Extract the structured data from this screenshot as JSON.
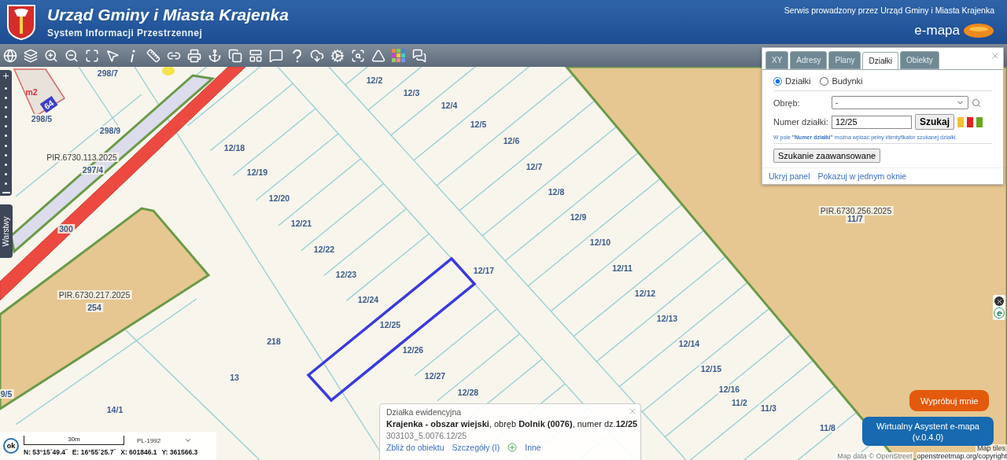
{
  "header": {
    "title": "Urząd Gminy i Miasta Krajenka",
    "subtitle": "System Informacji Przestrzennej",
    "operator": "Serwis prowadzony przez Urząd Gminy i Miasta Krajenka",
    "brand": "e-mapa"
  },
  "map_labels": [
    {
      "text": "298/7",
      "kind": "parcel"
    },
    {
      "text": "298/5",
      "kind": "parcel"
    },
    {
      "text": "298/9",
      "kind": "parcel"
    },
    {
      "text": "PIR.6730.113.2025",
      "kind": "plan"
    },
    {
      "text": "297/4",
      "kind": "parcel"
    },
    {
      "text": "300",
      "kind": "parcel"
    },
    {
      "text": "PIR.6730.217.2025",
      "kind": "plan"
    },
    {
      "text": "254",
      "kind": "parcel"
    },
    {
      "text": "m2",
      "kind": "building"
    },
    {
      "text": "64",
      "kind": "number"
    },
    {
      "text": "12/2",
      "kind": "parcel"
    },
    {
      "text": "12/3",
      "kind": "parcel"
    },
    {
      "text": "12/4",
      "kind": "parcel"
    },
    {
      "text": "12/5",
      "kind": "parcel"
    },
    {
      "text": "12/6",
      "kind": "parcel"
    },
    {
      "text": "12/7",
      "kind": "parcel"
    },
    {
      "text": "12/8",
      "kind": "parcel"
    },
    {
      "text": "12/9",
      "kind": "parcel"
    },
    {
      "text": "12/10",
      "kind": "parcel"
    },
    {
      "text": "12/11",
      "kind": "parcel"
    },
    {
      "text": "12/12",
      "kind": "parcel"
    },
    {
      "text": "12/13",
      "kind": "parcel"
    },
    {
      "text": "12/14",
      "kind": "parcel"
    },
    {
      "text": "12/15",
      "kind": "parcel"
    },
    {
      "text": "12/16",
      "kind": "parcel"
    },
    {
      "text": "11/2",
      "kind": "parcel"
    },
    {
      "text": "11/3",
      "kind": "parcel"
    },
    {
      "text": "11/8",
      "kind": "parcel"
    },
    {
      "text": "PIR.6730.256.2025",
      "kind": "plan"
    },
    {
      "text": "11/7",
      "kind": "parcel"
    },
    {
      "text": "12/18",
      "kind": "parcel"
    },
    {
      "text": "12/19",
      "kind": "parcel"
    },
    {
      "text": "12/20",
      "kind": "parcel"
    },
    {
      "text": "12/21",
      "kind": "parcel"
    },
    {
      "text": "12/22",
      "kind": "parcel"
    },
    {
      "text": "12/23",
      "kind": "parcel"
    },
    {
      "text": "12/24",
      "kind": "parcel"
    },
    {
      "text": "12/25",
      "kind": "parcel"
    },
    {
      "text": "12/26",
      "kind": "parcel"
    },
    {
      "text": "12/27",
      "kind": "parcel"
    },
    {
      "text": "12/28",
      "kind": "parcel"
    },
    {
      "text": "12/17",
      "kind": "parcel"
    },
    {
      "text": "218",
      "kind": "parcel"
    },
    {
      "text": "13",
      "kind": "parcel"
    },
    {
      "text": "14/1",
      "kind": "parcel"
    },
    {
      "text": "9/5",
      "kind": "parcel"
    }
  ],
  "layers_tab": "Warstwy",
  "search_panel": {
    "tabs": [
      {
        "label": "XY",
        "selected": false
      },
      {
        "label": "Adresy",
        "selected": false
      },
      {
        "label": "Plany",
        "selected": false
      },
      {
        "label": "Działki",
        "selected": true
      },
      {
        "label": "Obiekty",
        "selected": false
      }
    ],
    "radios": [
      {
        "label": "Działki",
        "selected": true
      },
      {
        "label": "Budynki",
        "selected": false
      }
    ],
    "precinct": {
      "label": "Obręb:",
      "value": "-"
    },
    "parcel_number": {
      "label": "Numer działki:",
      "value": "12/25"
    },
    "search_button": "Szukaj",
    "swatches": [
      {
        "color": "#f2c230"
      },
      {
        "color": "#e8201c"
      },
      {
        "color": "#6aa51c"
      }
    ],
    "hint": "W pole **\"Numer działki\"** można wpisać pełny identyfikator szukanej działki.",
    "advanced_button": "Szukanie zaawansowane",
    "links": [
      "Ukryj panel",
      "Pokazuj w jednym oknie"
    ]
  },
  "popup": {
    "title": "Działka ewidencyjna",
    "description": "**Krajenka - obszar wiejski**, obręb **Dolnik (0076)**, numer dz.**12/25**",
    "identifier": "303103_5.0076.12/25",
    "links": [
      "Zbliż do obiektu",
      "Szczegóły (I)",
      "Inne"
    ]
  },
  "scale": {
    "distance": "30m",
    "projection": "PL-1992",
    "ok": "ok",
    "coordinates": [
      "N: 53°15´49.4˝",
      "E: 16°55´25.7˝",
      "X: 601846.1",
      "Y: 361566.3"
    ]
  },
  "attribution": {
    "tiles": "Map tiles",
    "data": "Map data © OpenStreet",
    "link": "openstreetmap.org/copyright"
  },
  "assistant": {
    "bubble": "Wypróbuj mnie",
    "title": "Wirtualny Asystent e-mapa",
    "version": "(v.0.4.0)"
  }
}
